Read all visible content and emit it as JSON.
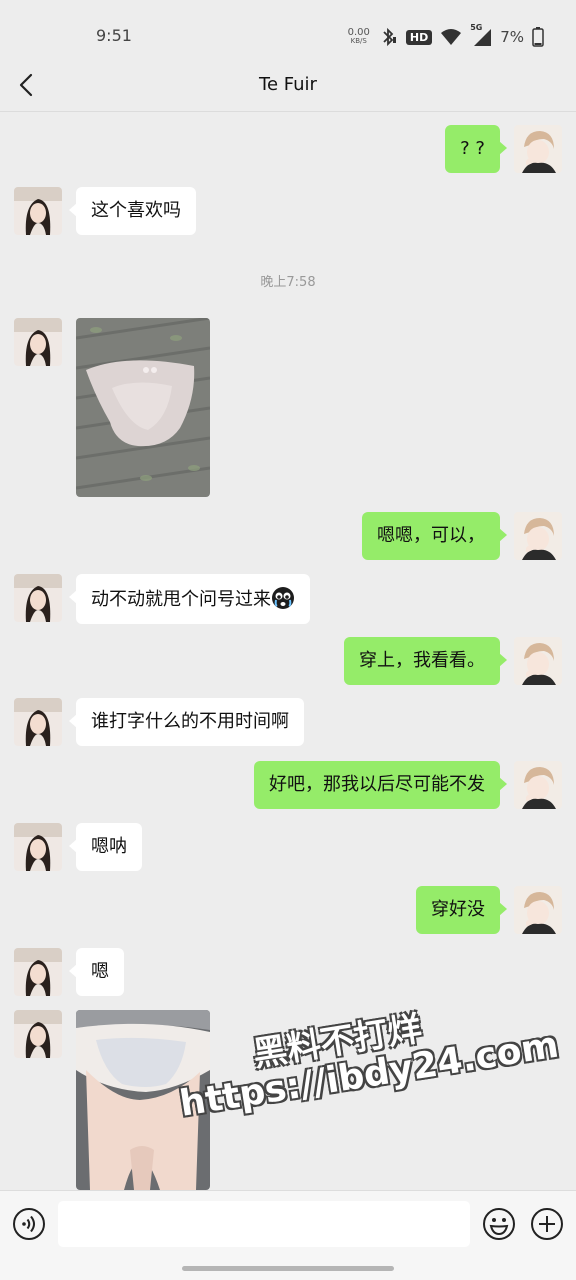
{
  "status_bar": {
    "time": "9:51",
    "net_speed_value": "0.00",
    "net_speed_unit": "KB/S",
    "hd_badge": "HD",
    "network_type": "5G",
    "battery": "7%"
  },
  "header": {
    "title": "Te Fuir",
    "back_icon": "chevron-left-icon"
  },
  "messages": [
    {
      "side": "right",
      "type": "text",
      "text": "? ?"
    },
    {
      "side": "left",
      "type": "text",
      "text": "这个喜欢吗"
    },
    {
      "type": "timestamp",
      "text": "晚上7:58"
    },
    {
      "side": "left",
      "type": "image",
      "description": "photo"
    },
    {
      "side": "right",
      "type": "text",
      "text": "嗯嗯，可以，"
    },
    {
      "side": "left",
      "type": "text",
      "text": "动不动就甩个问号过来",
      "emoji": "crying-face-icon"
    },
    {
      "side": "right",
      "type": "text",
      "text": "穿上，我看看。"
    },
    {
      "side": "left",
      "type": "text",
      "text": "谁打字什么的不用时间啊"
    },
    {
      "side": "right",
      "type": "text",
      "text": "好吧，那我以后尽可能不发"
    },
    {
      "side": "left",
      "type": "text",
      "text": "嗯呐"
    },
    {
      "side": "right",
      "type": "text",
      "text": "穿好没"
    },
    {
      "side": "left",
      "type": "text",
      "text": "嗯"
    },
    {
      "side": "left",
      "type": "image",
      "description": "photo"
    }
  ],
  "watermark": {
    "line1": "黑料不打烊",
    "line2": "https://ibdy24.com"
  },
  "input_bar": {
    "voice_icon": "voice-icon",
    "input_value": "",
    "emoji_icon": "emoji-icon",
    "plus_icon": "plus-icon"
  },
  "colors": {
    "background": "#ededed",
    "bubble_sent": "#95ec69",
    "bubble_received": "#ffffff"
  }
}
